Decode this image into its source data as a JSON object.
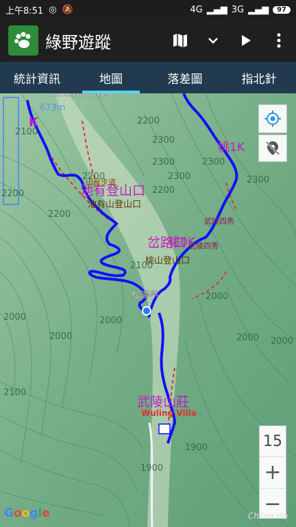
{
  "status_bar": {
    "time": "上午8:51",
    "network1": "4G",
    "network2": "3G",
    "battery": "97"
  },
  "app": {
    "title": "綠野遊蹤"
  },
  "tabs": [
    {
      "label": "統計資訊"
    },
    {
      "label": "地圖"
    },
    {
      "label": "落差圖"
    },
    {
      "label": "指北針"
    }
  ],
  "map_labels": {
    "trail_en": "Taoshan Trails",
    "alt_label": "673m",
    "chiyou_trailhead_big": "池有登山口",
    "chiyou_trailhead_small": "池有山登山口",
    "trail_sign": "山屋步道",
    "tao1k": "桃1K",
    "wuling_4_1": "武陵四秀",
    "junction": "岔路口",
    "tao0k": "桃0K",
    "wuling_4_2": "武陵四秀",
    "taoshan_trailhead": "桃山登山口",
    "songtao": "松濤亭",
    "wuling_villa_zh": "武陵山莊",
    "wuling_villa_en": "Wuling Villa",
    "k_marker": "K",
    "c2200a": "2200",
    "c2300a": "2300",
    "c2300b": "2300",
    "c2300c": "2300",
    "c2300d": "2300",
    "c2300e": "2300",
    "c2200b": "2200",
    "c2200c": "2200",
    "c2200d": "2200",
    "c2200e": "2200",
    "c2100a": "2100",
    "c2100b": "2100",
    "c2100c": "2100",
    "c2000a": "2000",
    "c2000b": "2000",
    "c2000c": "2000",
    "c2000d": "2000",
    "c2000e": "2000",
    "c2000f": "2000",
    "c1900a": "1900",
    "c1900b": "1900"
  },
  "zoom": {
    "level": "15",
    "plus": "+",
    "minus": "−"
  },
  "google": "Google",
  "watermark": "Chilun Ho",
  "colors": {
    "track": "#1010ff",
    "path": "#e03030",
    "label_purple": "#c020c0",
    "tab_active": "#5bd1ff"
  }
}
